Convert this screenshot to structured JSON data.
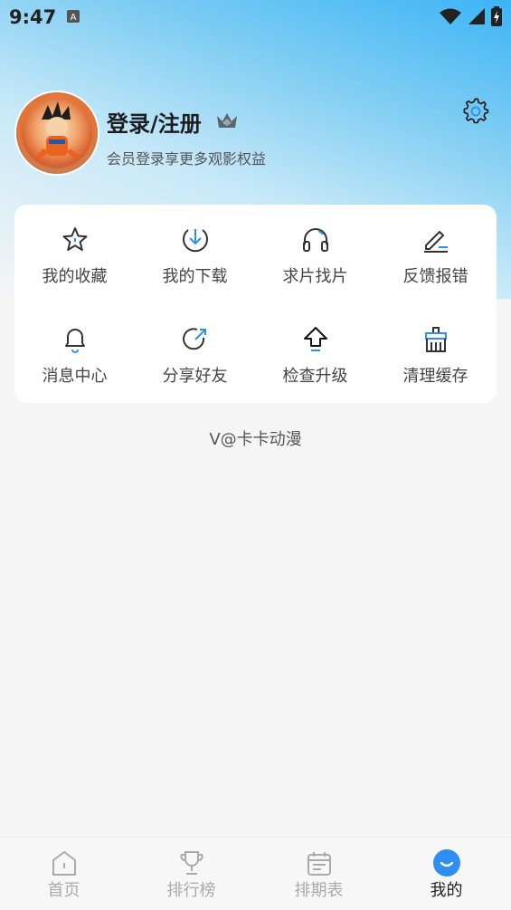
{
  "status_bar": {
    "time": "9:47"
  },
  "profile": {
    "title": "登录/注册",
    "subtitle": "会员登录享更多观影权益"
  },
  "grid": {
    "items": [
      {
        "label": "我的收藏",
        "icon": "star-icon"
      },
      {
        "label": "我的下载",
        "icon": "download-icon"
      },
      {
        "label": "求片找片",
        "icon": "headphones-icon"
      },
      {
        "label": "反馈报错",
        "icon": "edit-icon"
      },
      {
        "label": "消息中心",
        "icon": "bell-icon"
      },
      {
        "label": "分享好友",
        "icon": "share-icon"
      },
      {
        "label": "检查升级",
        "icon": "upgrade-icon"
      },
      {
        "label": "清理缓存",
        "icon": "broom-icon"
      }
    ]
  },
  "version": {
    "text": "V@卡卡动漫"
  },
  "tabs": [
    {
      "label": "首页",
      "icon": "home-icon",
      "active": false
    },
    {
      "label": "排行榜",
      "icon": "trophy-icon",
      "active": false
    },
    {
      "label": "排期表",
      "icon": "calendar-icon",
      "active": false
    },
    {
      "label": "我的",
      "icon": "smile-icon",
      "active": true
    }
  ],
  "colors": {
    "accent": "#2f8ff0",
    "tab_inactive": "#aaaaaa"
  }
}
